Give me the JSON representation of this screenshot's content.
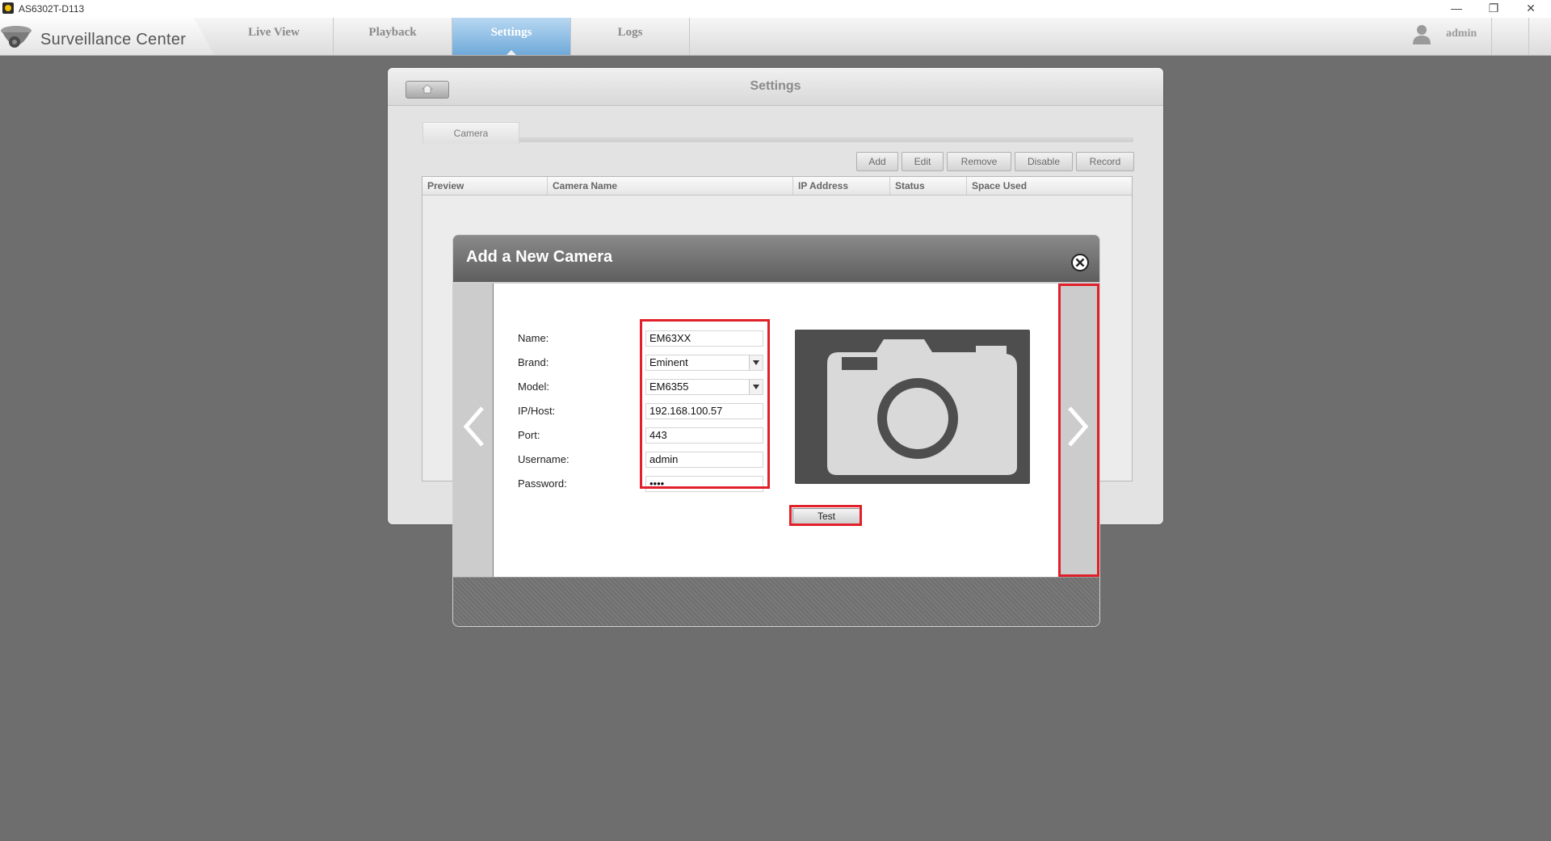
{
  "window": {
    "title": "AS6302T-D113",
    "minimize_glyph": "—",
    "restore_glyph": "❐",
    "close_glyph": "✕"
  },
  "app": {
    "name": "Surveillance Center",
    "nav": [
      {
        "label": "Live View",
        "active": false
      },
      {
        "label": "Playback",
        "active": false
      },
      {
        "label": "Settings",
        "active": true
      },
      {
        "label": "Logs",
        "active": false
      }
    ],
    "user": "admin"
  },
  "settings": {
    "title": "Settings",
    "sub_tab": "Camera",
    "toolbar": [
      "Add",
      "Edit",
      "Remove",
      "Disable",
      "Record"
    ],
    "columns": [
      "Preview",
      "Camera Name",
      "IP Address",
      "Status",
      "Space Used"
    ]
  },
  "dialog": {
    "title": "Add a New Camera",
    "fields": [
      {
        "label": "Name:",
        "value": "EM63XX",
        "type": "text"
      },
      {
        "label": "Brand:",
        "value": "Eminent",
        "type": "select"
      },
      {
        "label": "Model:",
        "value": "EM6355",
        "type": "select"
      },
      {
        "label": "IP/Host:",
        "value": "192.168.100.57",
        "type": "text"
      },
      {
        "label": "Port:",
        "value": "443",
        "type": "text"
      },
      {
        "label": "Username:",
        "value": "admin",
        "type": "text"
      },
      {
        "label": "Password:",
        "value": "••••",
        "type": "password"
      }
    ],
    "test_label": "Test",
    "preview_icon": "camera-icon",
    "highlight_color": "#e0202a"
  },
  "colors": {
    "active_tab": "#6fa9d9",
    "background": "#6e6e6e"
  }
}
